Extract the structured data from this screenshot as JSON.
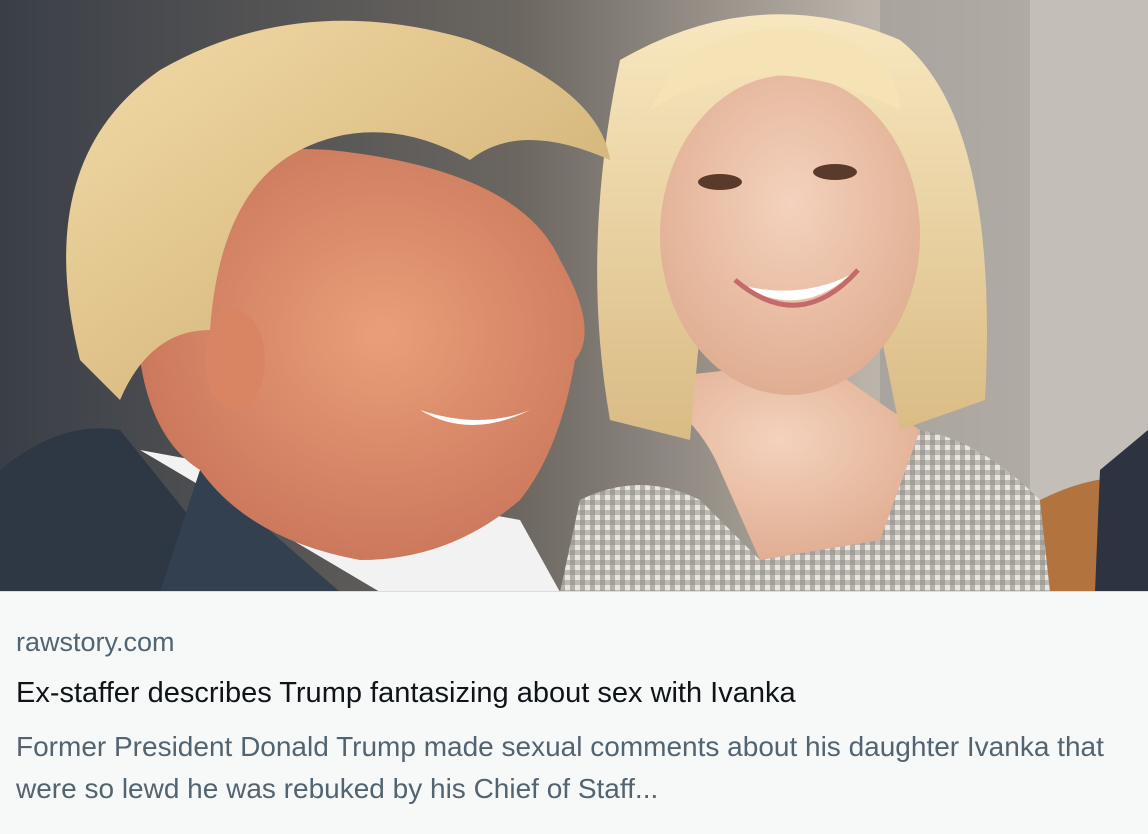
{
  "link_card": {
    "image": {
      "kind": "photo",
      "subject": "photo-of-smiling-man-and-blonde-woman"
    },
    "domain": "rawstory.com",
    "title": "Ex-staffer describes Trump fantasizing about sex with Ivanka",
    "description": "Former President Donald Trump made sexual comments about his daughter Ivanka that were so lewd he was rebuked by his Chief of Staff..."
  },
  "colors": {
    "domain_text": "#536471",
    "title_text": "#0f1419",
    "description_text": "#536471",
    "meta_background": "#f7f9f9"
  }
}
